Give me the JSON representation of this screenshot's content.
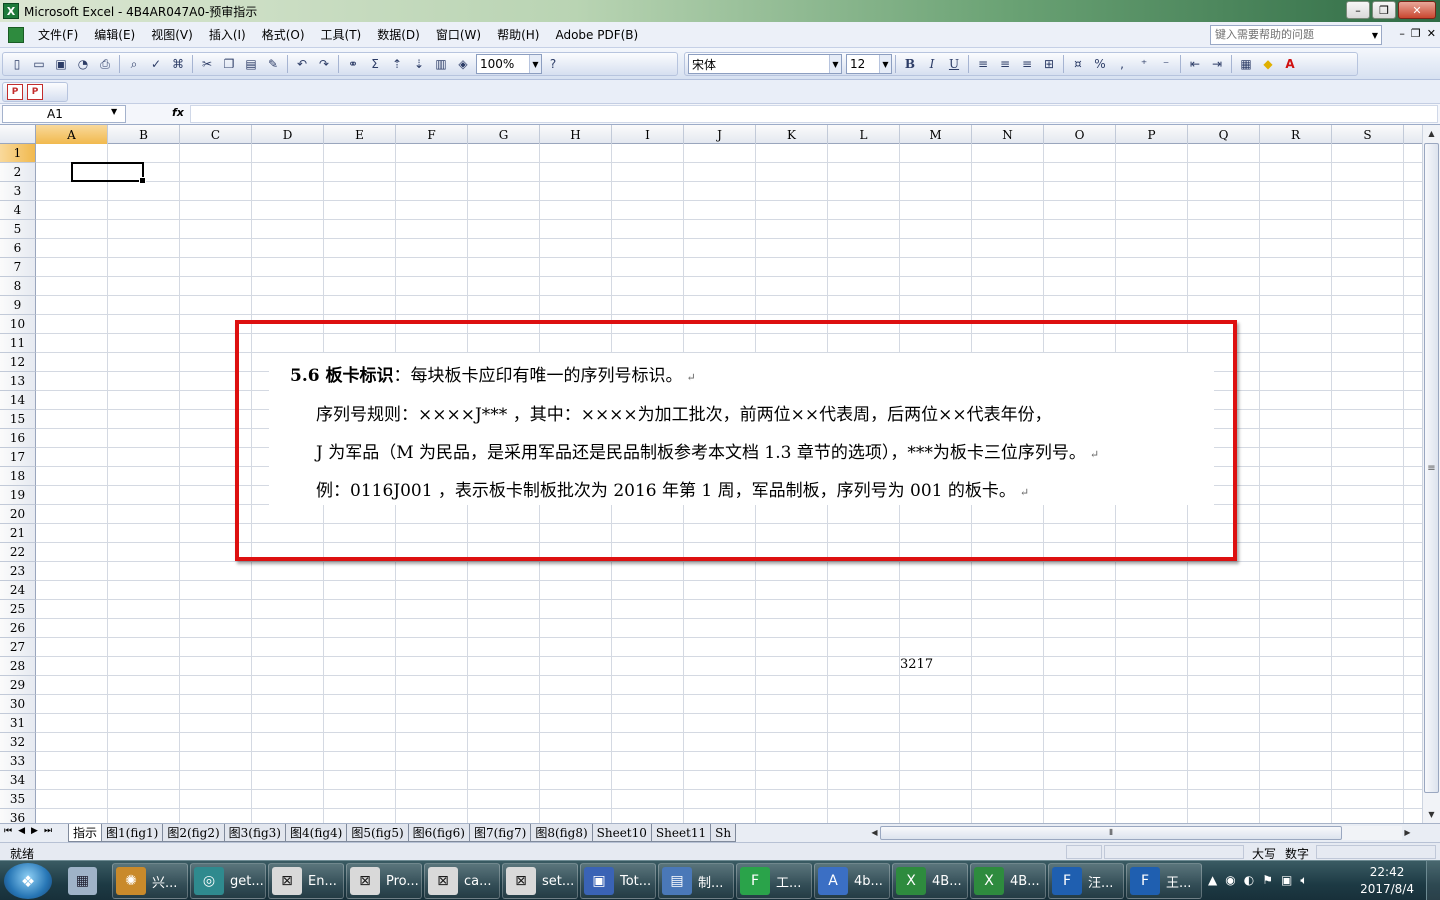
{
  "window": {
    "title": "Microsoft Excel - 4B4AR047A0-预审指示",
    "minimize": "–",
    "restore": "❐",
    "close": "✕"
  },
  "menu": {
    "items": [
      "文件(F)",
      "编辑(E)",
      "视图(V)",
      "插入(I)",
      "格式(O)",
      "工具(T)",
      "数据(D)",
      "窗口(W)",
      "帮助(H)",
      "Adobe PDF(B)"
    ],
    "help_placeholder": "键入需要帮助的问题",
    "doc_min": "–",
    "doc_restore": "❐",
    "doc_close": "✕"
  },
  "toolbar": {
    "zoom": "100%",
    "font": "宋体",
    "font_size": "12",
    "bold": "B",
    "italic": "I",
    "underline": "U",
    "percent": "%",
    "comma": ",",
    "sum": "Σ",
    "icons": [
      "new-icon",
      "open-icon",
      "save-icon",
      "permission-icon",
      "print-icon",
      "print-preview-icon",
      "spelling-icon",
      "research-icon",
      "cut-icon",
      "copy-icon",
      "paste-icon",
      "format-painter-icon",
      "undo-icon",
      "redo-icon",
      "hyperlink-icon",
      "autosum-icon",
      "sort-ascending-icon",
      "sort-descending-icon",
      "chart-wizard-icon",
      "drawing-icon",
      "help-icon",
      "align-left-icon",
      "center-icon",
      "align-right-icon",
      "merge-center-icon",
      "currency-icon",
      "increase-decimal-icon",
      "decrease-decimal-icon",
      "decrease-indent-icon",
      "increase-indent-icon",
      "borders-icon",
      "fill-color-icon",
      "font-color-icon"
    ]
  },
  "formula_bar": {
    "name_box": "A1",
    "fx": "fx",
    "value": ""
  },
  "grid": {
    "columns": [
      "A",
      "B",
      "C",
      "D",
      "E",
      "F",
      "G",
      "H",
      "I",
      "J",
      "K",
      "L",
      "M",
      "N",
      "O",
      "P",
      "Q",
      "R",
      "S"
    ],
    "rows": [
      "1",
      "2",
      "3",
      "4",
      "5",
      "6",
      "7",
      "8",
      "9",
      "10",
      "11",
      "12",
      "13",
      "14",
      "15",
      "16",
      "17",
      "18",
      "19",
      "20",
      "21",
      "22",
      "23",
      "24",
      "25",
      "26",
      "27",
      "28",
      "29",
      "30",
      "31",
      "32",
      "33",
      "34",
      "35",
      "36"
    ],
    "active_cell": "A1",
    "cell_L27": "3217"
  },
  "picture": {
    "line1_heading": "5.6 板卡标识",
    "line1_text": "：每块板卡应印有唯一的序列号标识。",
    "line2": "序列号规则：××××J*** ，其中：××××为加工批次，前两位××代表周，后两位××代表年份，",
    "line3": "J 为军品（M 为民品，是采用军品还是民品制板参考本文档 1.3 章节的选项），***为板卡三位序列号。",
    "line4": "例：0116J001 ，表示板卡制板批次为 2016 年第 1 周，军品制板，序列号为 001 的板卡。",
    "return_mark": "↵",
    "highlight_color": "#dd1010"
  },
  "sheet_tabs": [
    "指示",
    "图1(fig1)",
    "图2(fig2)",
    "图3(fig3)",
    "图4(fig4)",
    "图5(fig5)",
    "图6(fig6)",
    "图7(fig7)",
    "图8(fig8)",
    "Sheet10",
    "Sheet11",
    "Sh"
  ],
  "active_tab": "指示",
  "status": {
    "ready": "就绪",
    "caps": "大写",
    "num": "数字"
  },
  "taskbar": {
    "tasks": [
      "兴...",
      "get...",
      "En...",
      "Pro...",
      "ca...",
      "set...",
      "Tot...",
      "制...",
      "工...",
      "4b...",
      "4B...",
      "4B...",
      "汪...",
      "王..."
    ],
    "time": "22:42",
    "date": "2017/8/4"
  }
}
